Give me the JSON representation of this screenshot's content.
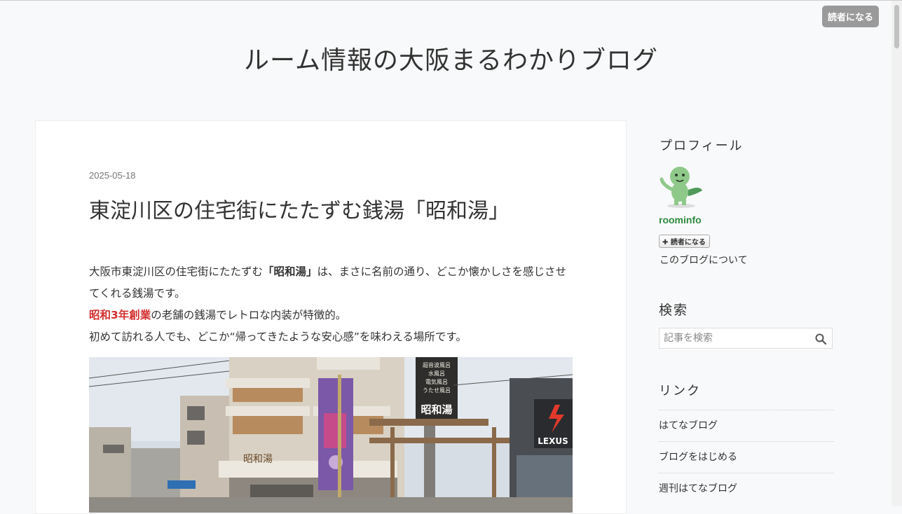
{
  "header": {
    "subscribe_label": "読者になる",
    "blog_title": "ルーム情報の大阪まるわかりブログ"
  },
  "entry": {
    "date": "2025-05-18",
    "title": "東淀川区の住宅街にたたずむ銭湯「昭和湯」",
    "p1_pre": "大阪市東淀川区の住宅街にたたずむ",
    "p1_bold": "「昭和湯」",
    "p1_post": "は、まさに名前の通り、どこか懐かしさを感じさせてくれる銭湯です。",
    "p2_highlight": "昭和3年創業",
    "p2_post": "の老舗の銭湯でレトロな内装が特徴的。",
    "p3": "初めて訪れる人でも、どこか“帰ってきたような安心感”を味わえる場所です。",
    "photo": {
      "sign_main": "昭和湯",
      "sign_items": [
        "超音波風呂",
        "水風呂",
        "電気風呂",
        "うたせ風呂"
      ],
      "awning_text": "昭和湯",
      "store_sign": "LEXUS"
    }
  },
  "sidebar": {
    "profile_heading": "プロフィール",
    "username": "roominfo",
    "subscribe_label": "読者になる",
    "about_link": "このブログについて",
    "search_heading": "検索",
    "search_placeholder": "記事を検索",
    "links_heading": "リンク",
    "links": [
      "はてなブログ",
      "ブログをはじめる",
      "週刊はてなブログ"
    ]
  }
}
